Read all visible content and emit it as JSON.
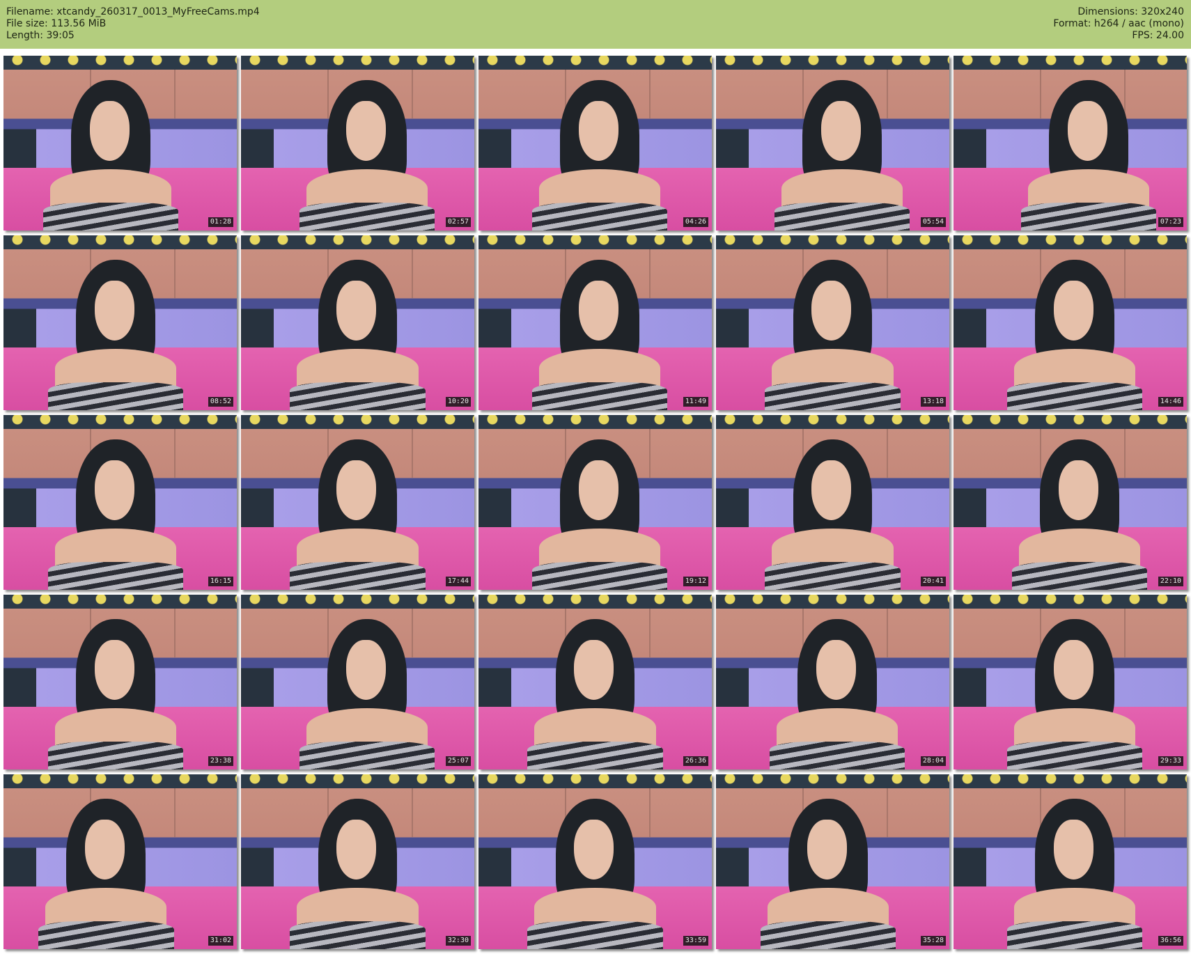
{
  "header": {
    "filename": "Filename: xtcandy_260317_0013_MyFreeCams.mp4",
    "file_size": "File size: 113.56 MiB",
    "length": "Length: 39:05",
    "dimensions": "Dimensions: 320x240",
    "format": "Format: h264 / aac (mono)",
    "fps": "FPS: 24.00"
  },
  "colors": {
    "header_bg": "#b3cd7e"
  },
  "thumbnails": [
    "01:28",
    "02:57",
    "04:26",
    "05:54",
    "07:23",
    "08:52",
    "10:20",
    "11:49",
    "13:18",
    "14:46",
    "16:15",
    "17:44",
    "19:12",
    "20:41",
    "22:10",
    "23:38",
    "25:07",
    "26:36",
    "28:04",
    "29:33",
    "31:02",
    "32:30",
    "33:59",
    "35:28",
    "36:56"
  ]
}
